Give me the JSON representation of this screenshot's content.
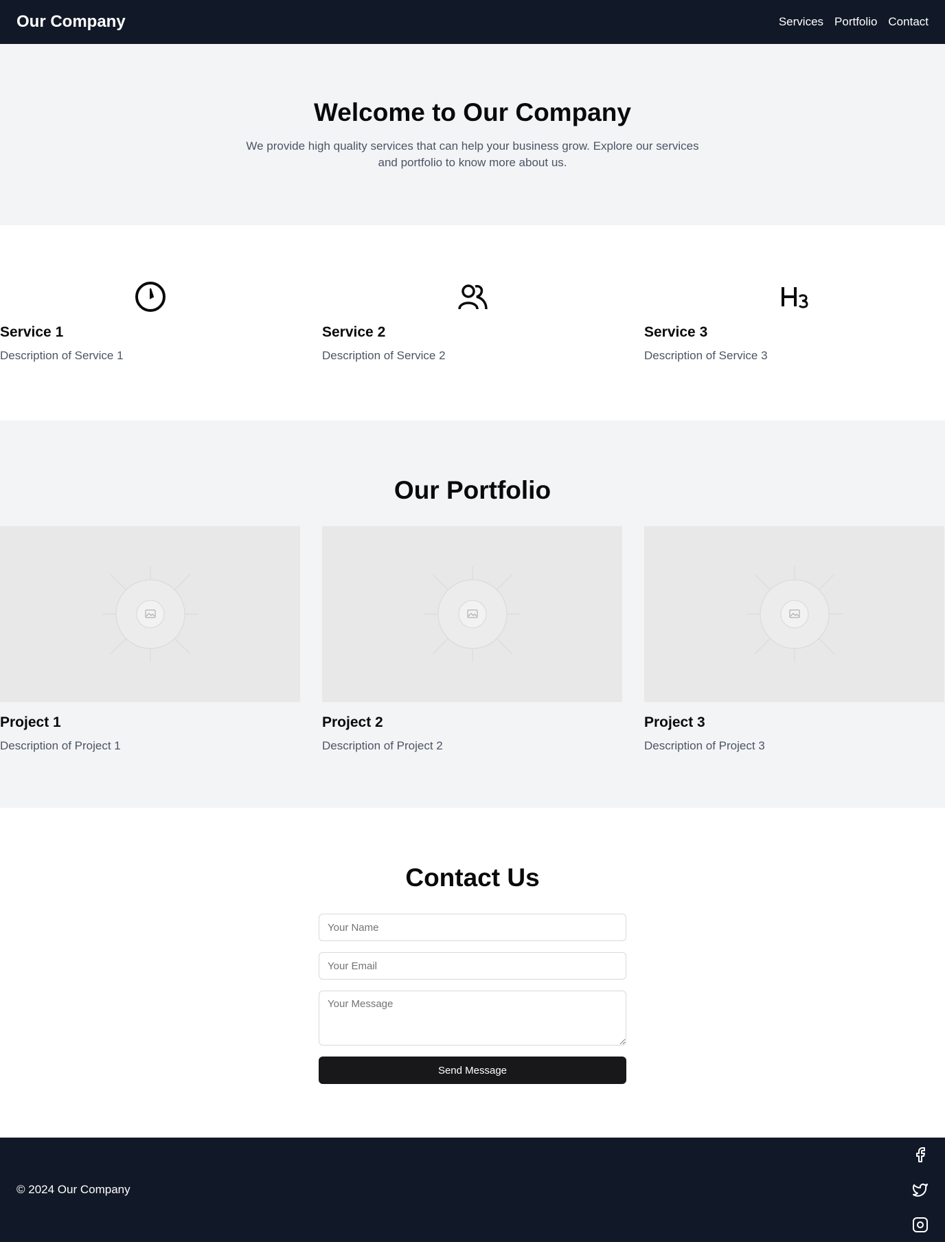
{
  "header": {
    "brand": "Our Company",
    "nav": [
      "Services",
      "Portfolio",
      "Contact"
    ]
  },
  "hero": {
    "title": "Welcome to Our Company",
    "text": "We provide high quality services that can help your business grow. Explore our services and portfolio to know more about us."
  },
  "services": {
    "items": [
      {
        "title": "Service 1",
        "description": "Description of Service 1",
        "icon": "clock-icon"
      },
      {
        "title": "Service 2",
        "description": "Description of Service 2",
        "icon": "users-icon"
      },
      {
        "title": "Service 3",
        "description": "Description of Service 3",
        "icon": "heading-3-icon"
      }
    ]
  },
  "portfolio": {
    "title": "Our Portfolio",
    "items": [
      {
        "title": "Project 1",
        "description": "Description of Project 1"
      },
      {
        "title": "Project 2",
        "description": "Description of Project 2"
      },
      {
        "title": "Project 3",
        "description": "Description of Project 3"
      }
    ]
  },
  "contact": {
    "title": "Contact Us",
    "name_placeholder": "Your Name",
    "email_placeholder": "Your Email",
    "message_placeholder": "Your Message",
    "send_label": "Send Message"
  },
  "footer": {
    "copyright": "© 2024 Our Company",
    "socials": [
      "facebook-icon",
      "twitter-icon",
      "instagram-icon"
    ]
  },
  "colors": {
    "dark": "#111827",
    "hero_bg": "#f3f4f6",
    "muted_text": "#4b5563",
    "button": "#18181b"
  }
}
